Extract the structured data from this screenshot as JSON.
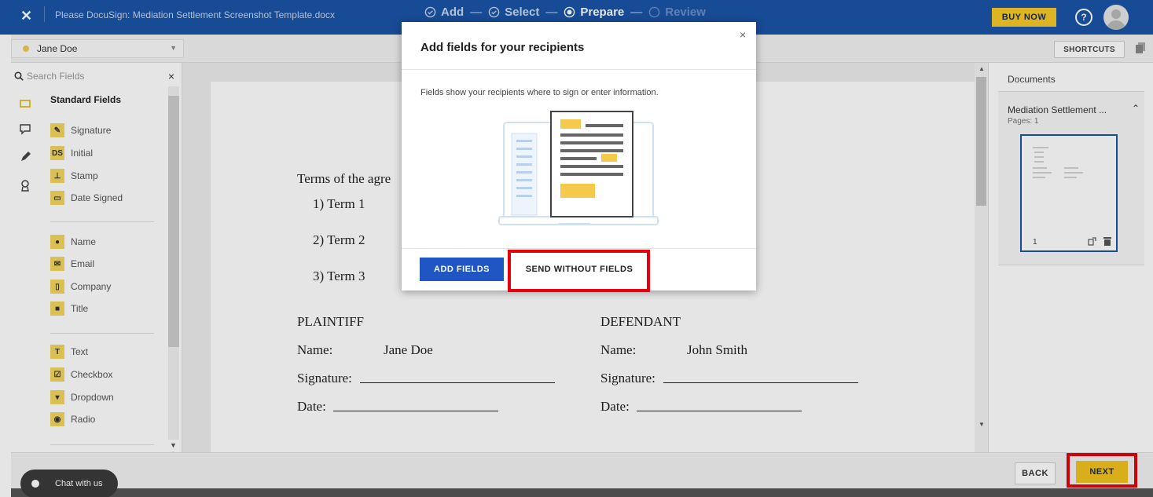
{
  "topbar": {
    "close": "✕",
    "doc_title": "Please DocuSign: Mediation Settlement Screenshot Template.docx",
    "steps": [
      {
        "label": "Add",
        "icon": "check-circle-icon"
      },
      {
        "label": "Select",
        "icon": "check-circle-icon"
      },
      {
        "label": "Prepare",
        "icon": "radio-filled-icon"
      },
      {
        "label": "Review",
        "icon": "radio-empty-icon"
      }
    ],
    "buy_now": "BUY NOW",
    "help": "?"
  },
  "subbar": {
    "recipient": "Jane Doe",
    "shortcuts": "SHORTCUTS"
  },
  "left_panel": {
    "search_placeholder": "Search Fields",
    "section_title": "Standard Fields",
    "fields": [
      {
        "label": "Signature",
        "icon": "signature-icon",
        "glyph": "✎"
      },
      {
        "label": "Initial",
        "icon": "initial-icon",
        "glyph": "DS"
      },
      {
        "label": "Stamp",
        "icon": "stamp-icon",
        "glyph": "⊥"
      },
      {
        "label": "Date Signed",
        "icon": "calendar-icon",
        "glyph": "▭"
      },
      {
        "label": "Name",
        "icon": "person-icon",
        "glyph": "●"
      },
      {
        "label": "Email",
        "icon": "email-icon",
        "glyph": "✉"
      },
      {
        "label": "Company",
        "icon": "company-icon",
        "glyph": "▯"
      },
      {
        "label": "Title",
        "icon": "briefcase-icon",
        "glyph": "■"
      },
      {
        "label": "Text",
        "icon": "text-icon",
        "glyph": "T"
      },
      {
        "label": "Checkbox",
        "icon": "checkbox-icon",
        "glyph": "☑"
      },
      {
        "label": "Dropdown",
        "icon": "dropdown-icon",
        "glyph": "▾"
      },
      {
        "label": "Radio",
        "icon": "radio-icon",
        "glyph": "◉"
      }
    ]
  },
  "document": {
    "terms_heading": "Terms of the agre",
    "terms": [
      "1)  Term 1",
      "2)  Term 2",
      "3)  Term 3"
    ],
    "plaintiff": {
      "heading": "PLAINTIFF",
      "name_label": "Name:",
      "name_value": "Jane Doe",
      "signature_label": "Signature:",
      "date_label": "Date:"
    },
    "defendant": {
      "heading": "DEFENDANT",
      "name_label": "Name:",
      "name_value": "John Smith",
      "signature_label": "Signature:",
      "date_label": "Date:"
    }
  },
  "right_panel": {
    "title": "Documents",
    "doc_name": "Mediation Settlement ...",
    "pages": "Pages: 1",
    "page_number": "1"
  },
  "bottombar": {
    "back": "BACK",
    "next": "NEXT",
    "chat": "Chat with us"
  },
  "modal": {
    "title": "Add fields for your recipients",
    "close": "×",
    "description": "Fields show your recipients where to sign or enter information.",
    "add_fields": "ADD FIELDS",
    "send_without_fields": "SEND WITHOUT FIELDS"
  },
  "colors": {
    "brand_blue": "#1a54a6",
    "accent_yellow": "#f1c31f",
    "highlight_red": "#e8000b",
    "primary_button": "#1f56c3"
  }
}
